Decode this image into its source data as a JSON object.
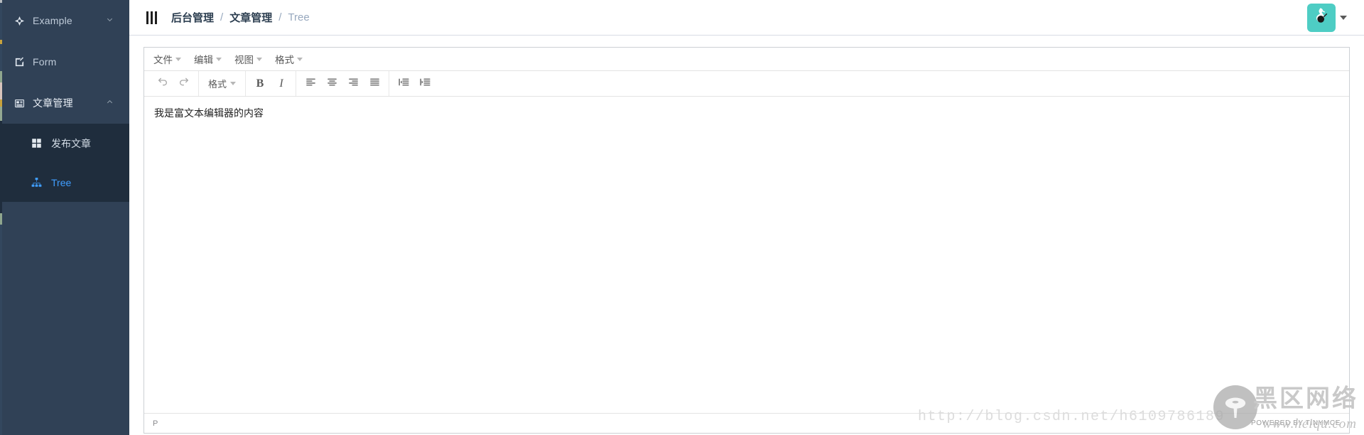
{
  "sidebar": {
    "items": [
      {
        "label": "Example",
        "icon": "compass-icon",
        "arrow": "chevron-down",
        "expanded": false
      },
      {
        "label": "Form",
        "icon": "edit-square-icon",
        "arrow": "",
        "expanded": false
      },
      {
        "label": "文章管理",
        "icon": "newspaper-icon",
        "arrow": "chevron-up",
        "expanded": true
      }
    ],
    "submenu": [
      {
        "label": "发布文章",
        "icon": "grid-icon",
        "selected": false
      },
      {
        "label": "Tree",
        "icon": "sitemap-icon",
        "selected": true
      }
    ]
  },
  "topbar": {
    "hamburger_icon": "hamburger-icon",
    "breadcrumb": [
      {
        "label": "后台管理",
        "current": false
      },
      {
        "label": "文章管理",
        "current": false
      },
      {
        "label": "Tree",
        "current": true
      }
    ],
    "separator": "/",
    "avatar_icon": "user-avatar-icon",
    "avatar_color": "#4ecdc4",
    "dropdown_icon": "caret-down-icon"
  },
  "editor": {
    "menubar": [
      {
        "label": "文件"
      },
      {
        "label": "编辑"
      },
      {
        "label": "视图"
      },
      {
        "label": "格式"
      }
    ],
    "toolbar_groups": [
      [
        {
          "name": "undo-button",
          "icon": "undo-icon",
          "label": ""
        },
        {
          "name": "redo-button",
          "icon": "redo-icon",
          "label": ""
        }
      ],
      [
        {
          "name": "format-dropdown",
          "icon": "",
          "label": "格式"
        }
      ],
      [
        {
          "name": "bold-button",
          "icon": "bold-icon",
          "label": "B"
        },
        {
          "name": "italic-button",
          "icon": "italic-icon",
          "label": "I"
        }
      ],
      [
        {
          "name": "align-left-button",
          "icon": "align-left-icon",
          "label": ""
        },
        {
          "name": "align-center-button",
          "icon": "align-center-icon",
          "label": ""
        },
        {
          "name": "align-right-button",
          "icon": "align-right-icon",
          "label": ""
        },
        {
          "name": "align-justify-button",
          "icon": "align-justify-icon",
          "label": ""
        }
      ],
      [
        {
          "name": "outdent-button",
          "icon": "outdent-icon",
          "label": ""
        },
        {
          "name": "indent-button",
          "icon": "indent-icon",
          "label": ""
        }
      ]
    ],
    "content": "我是富文本编辑器的内容",
    "status_path": "P",
    "status_brand": "POWERED BY TINYMCE"
  },
  "watermarks": {
    "blog_url": "http://blog.csdn.net/h6109786189",
    "brand_cn": "黑区网络",
    "brand_site": "www.heiqu.com"
  },
  "colors": {
    "sidebar_bg": "#304156",
    "submenu_bg": "#1f2d3d",
    "accent_blue": "#409eff",
    "avatar_teal": "#4ecdc4",
    "breadcrumb_text": "#2c3e50",
    "breadcrumb_muted": "#97a8be"
  }
}
